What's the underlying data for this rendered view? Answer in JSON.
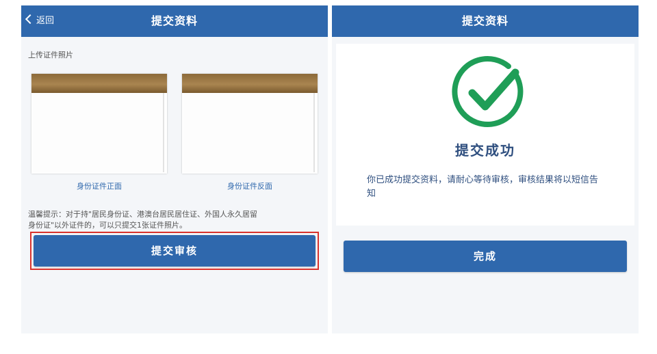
{
  "left_screen": {
    "title": "提交资料",
    "back_label": "返回",
    "section_label": "上传证件照片",
    "front_caption": "身份证件正面",
    "back_caption": "身份证件反面",
    "tip_line1": "温馨提示：对于持\"居民身份证、港澳台居民居住证、外国人永久居留",
    "tip_line2": "身份证\"以外证件的，可以只提交1张证件照片。",
    "submit_button": "提交审核"
  },
  "right_screen": {
    "title": "提交资料",
    "success_title": "提交成功",
    "success_message": "你已成功提交资料，请耐心等待审核，审核结果将以短信告知",
    "done_button": "完成"
  },
  "colors": {
    "brand": "#2f68ad",
    "success_green": "#1f9e57",
    "highlight": "#d9322c"
  },
  "icons": [
    "chevron-left-icon",
    "check-circle-icon"
  ]
}
